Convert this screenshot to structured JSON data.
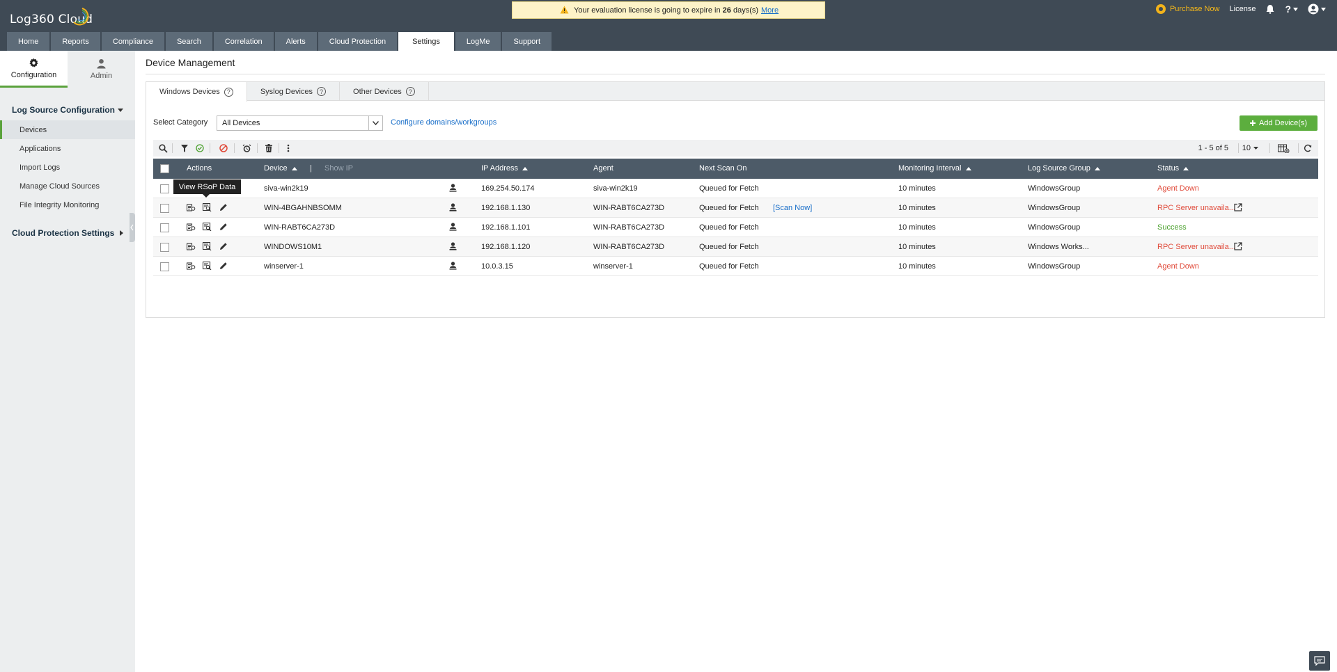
{
  "header": {
    "logo_text": "Log360 Cloud",
    "banner": {
      "prefix": "Your evaluation license is going to expire in",
      "days": "26",
      "suffix": "days(s)",
      "more": "More"
    },
    "purchase_now": "Purchase Now",
    "license": "License"
  },
  "tabs": [
    "Home",
    "Reports",
    "Compliance",
    "Search",
    "Correlation",
    "Alerts",
    "Cloud Protection",
    "Settings",
    "LogMe",
    "Support"
  ],
  "active_tab": "Settings",
  "sidebar": {
    "modes": [
      "Configuration",
      "Admin"
    ],
    "section1": "Log Source Configuration",
    "items": [
      "Devices",
      "Applications",
      "Import Logs",
      "Manage Cloud Sources",
      "File Integrity Monitoring"
    ],
    "section2": "Cloud Protection Settings"
  },
  "main": {
    "title": "Device Management",
    "subtabs": [
      "Windows Devices",
      "Syslog Devices",
      "Other Devices"
    ],
    "select_category_label": "Select Category",
    "category_value": "All Devices",
    "configure_link": "Configure domains/workgroups",
    "add_button": "Add Device(s)",
    "pager": "1 - 5 of 5",
    "page_size": "10",
    "tooltip": "View RSoP Data"
  },
  "table": {
    "headers": [
      "Actions",
      "Device",
      "Show IP",
      "IP Address",
      "Agent",
      "Next Scan On",
      "Monitoring Interval",
      "Log Source Group",
      "Status"
    ],
    "rows": [
      {
        "device": "siva-win2k19",
        "ip": "169.254.50.174",
        "agent": "siva-win2k19",
        "next_scan": "Queued for Fetch",
        "scan_now": "",
        "interval": "10 minutes",
        "group": "WindowsGroup",
        "status": "Agent Down",
        "status_color": "#e04a3a",
        "ext": false
      },
      {
        "device": "WIN-4BGAHNBSOMM",
        "ip": "192.168.1.130",
        "agent": "WIN-RABT6CA273D",
        "next_scan": "Queued for Fetch",
        "scan_now": "[Scan Now]",
        "interval": "10 minutes",
        "group": "WindowsGroup",
        "status": "RPC Server unavaila...",
        "status_color": "#e04a3a",
        "ext": true
      },
      {
        "device": "WIN-RABT6CA273D",
        "ip": "192.168.1.101",
        "agent": "WIN-RABT6CA273D",
        "next_scan": "Queued for Fetch",
        "scan_now": "",
        "interval": "10 minutes",
        "group": "WindowsGroup",
        "status": "Success",
        "status_color": "#4aa02c",
        "ext": false
      },
      {
        "device": "WINDOWS10M1",
        "ip": "192.168.1.120",
        "agent": "WIN-RABT6CA273D",
        "next_scan": "Queued for Fetch",
        "scan_now": "",
        "interval": "10 minutes",
        "group": "Windows Works...",
        "status": "RPC Server unavaila...",
        "status_color": "#e04a3a",
        "ext": true
      },
      {
        "device": "winserver-1",
        "ip": "10.0.3.15",
        "agent": "winserver-1",
        "next_scan": "Queued for Fetch",
        "scan_now": "",
        "interval": "10 minutes",
        "group": "WindowsGroup",
        "status": "Agent Down",
        "status_color": "#e04a3a",
        "ext": false
      }
    ]
  },
  "colors": {
    "header_bg": "#3f4a55",
    "accent_green": "#5cae3e",
    "link_blue": "#1a6fc9",
    "error_red": "#e04a3a"
  }
}
